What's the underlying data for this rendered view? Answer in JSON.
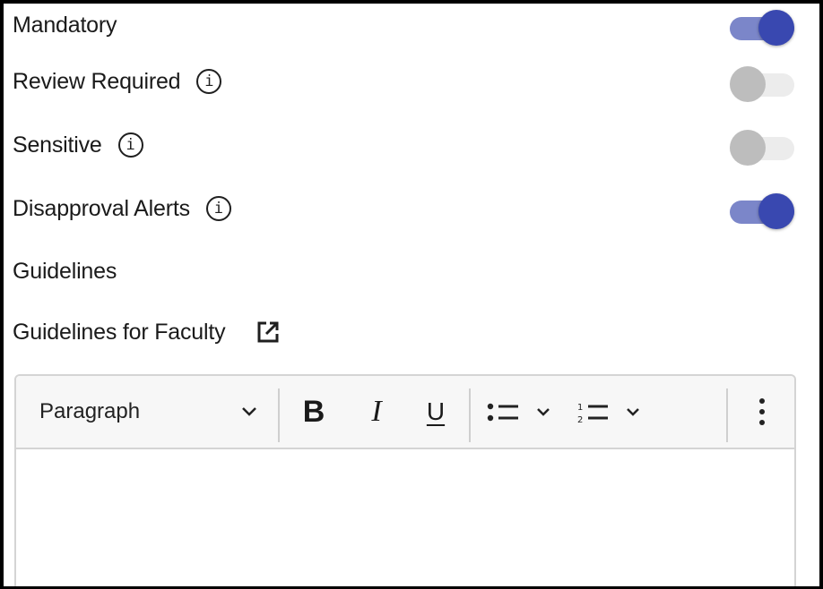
{
  "settings": [
    {
      "label": "Mandatory",
      "info": false,
      "toggle": true
    },
    {
      "label": "Review Required",
      "info": true,
      "toggle": false
    },
    {
      "label": "Sensitive",
      "info": true,
      "toggle": false
    },
    {
      "label": "Disapproval Alerts",
      "info": true,
      "toggle": true
    }
  ],
  "guidelines": {
    "section_title": "Guidelines",
    "link_label": "Guidelines for Faculty",
    "link_icon": "external-link-icon"
  },
  "editor": {
    "block_format": "Paragraph",
    "bold_glyph": "B",
    "italic_glyph": "I",
    "underline_glyph": "U",
    "icons": [
      "chevron-down-icon",
      "bulleted-list-icon",
      "numbered-list-icon",
      "more-vertical-icon"
    ],
    "content": ""
  },
  "colors": {
    "toggle_on_thumb": "#3948b0",
    "toggle_on_track": "#7b86c9",
    "toggle_off_thumb": "#bdbdbd",
    "toggle_off_track": "#ececec"
  }
}
